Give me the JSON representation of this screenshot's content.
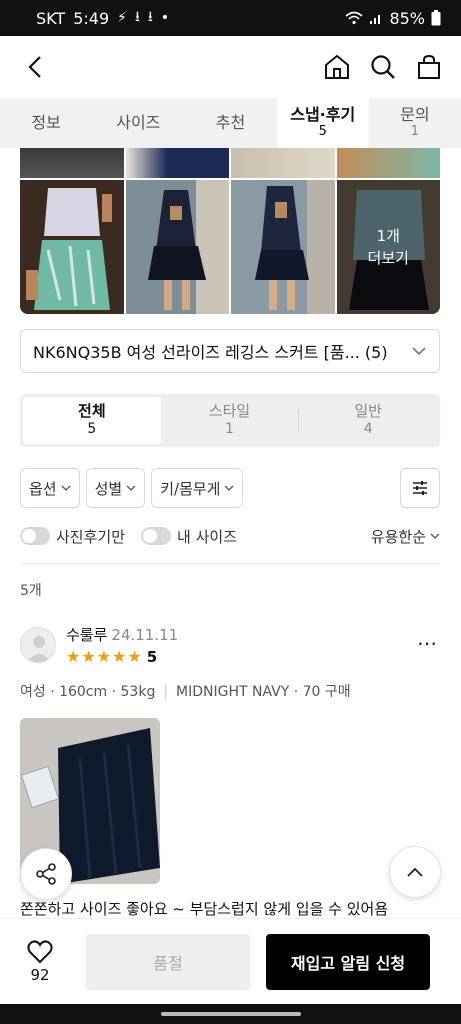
{
  "status_bar": {
    "carrier": "SKT",
    "time": "5:49",
    "battery": "85%"
  },
  "app_bar": {
    "back_icon": "chevron-left-icon",
    "home_icon": "home-icon",
    "search_icon": "search-icon",
    "bag_icon": "shopping-bag-icon"
  },
  "tabs": [
    {
      "label": "정보",
      "count": ""
    },
    {
      "label": "사이즈",
      "count": ""
    },
    {
      "label": "추천",
      "count": ""
    },
    {
      "label": "스냅·후기",
      "count": "5",
      "active": true
    },
    {
      "label": "문의",
      "count": "1"
    }
  ],
  "photos": {
    "more_count": "1개",
    "more_label": "더보기"
  },
  "product_select": {
    "value": "NK6NQ35B 여성 선라이즈 레깅스 스커트 [품... (5)"
  },
  "segments": [
    {
      "label": "전체",
      "count": "5",
      "active": true
    },
    {
      "label": "스타일",
      "count": "1"
    },
    {
      "label": "일반",
      "count": "4"
    }
  ],
  "filters": {
    "option": "옵션",
    "gender": "성별",
    "height_weight": "키/몸무게"
  },
  "toggles": {
    "photo_only": "사진후기만",
    "my_size": "내 사이즈",
    "sort": "유용한순"
  },
  "review_count": "5개",
  "review": {
    "name": "수룰루",
    "date": "24.11.11",
    "rating": "5",
    "meta_body": "여성 · 160cm · 53kg",
    "meta_option": "MIDNIGHT NAVY · 70 구매",
    "text": "쫀쫀하고 사이즈 좋아요 ~ 부담스럽지 않게 입을 수 있어욤"
  },
  "bottom": {
    "likes": "92",
    "soldout_label": "품절",
    "restock_label": "재입고 알림 신청"
  }
}
